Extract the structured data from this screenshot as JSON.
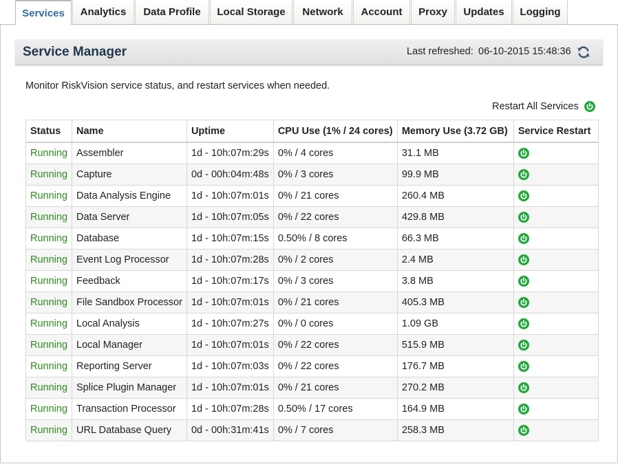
{
  "tabs": [
    {
      "label": "Services",
      "active": true
    },
    {
      "label": "Analytics"
    },
    {
      "label": "Data Profile"
    },
    {
      "label": "Local Storage"
    },
    {
      "label": "Network"
    },
    {
      "label": "Account"
    },
    {
      "label": "Proxy"
    },
    {
      "label": "Updates"
    },
    {
      "label": "Logging"
    }
  ],
  "header": {
    "title": "Service Manager",
    "refresh_label": "Last refreshed:",
    "refresh_value": "06-10-2015 15:48:36",
    "refresh_icon": "refresh-icon"
  },
  "description": "Monitor RiskVision service status, and restart services when needed.",
  "restart_all": {
    "label": "Restart All Services",
    "icon": "power-icon"
  },
  "colors": {
    "accent": "#2f6da1",
    "running": "#2d8a1e",
    "power_green": "#22a83a"
  },
  "table": {
    "columns": [
      "Status",
      "Name",
      "Uptime",
      "CPU Use (1% / 24 cores)",
      "Memory Use (3.72 GB)",
      "Service Restart"
    ],
    "rows": [
      {
        "status": "Running",
        "name": "Assembler",
        "uptime": "1d - 10h:07m:29s",
        "cpu": "0% / 4 cores",
        "mem": "31.1 MB"
      },
      {
        "status": "Running",
        "name": "Capture",
        "uptime": "0d - 00h:04m:48s",
        "cpu": "0% / 3 cores",
        "mem": "99.9 MB"
      },
      {
        "status": "Running",
        "name": "Data Analysis Engine",
        "uptime": "1d - 10h:07m:01s",
        "cpu": "0% / 21 cores",
        "mem": "260.4 MB"
      },
      {
        "status": "Running",
        "name": "Data Server",
        "uptime": "1d - 10h:07m:05s",
        "cpu": "0% / 22 cores",
        "mem": "429.8 MB"
      },
      {
        "status": "Running",
        "name": "Database",
        "uptime": "1d - 10h:07m:15s",
        "cpu": "0.50% / 8 cores",
        "mem": "66.3 MB"
      },
      {
        "status": "Running",
        "name": "Event Log Processor",
        "uptime": "1d - 10h:07m:28s",
        "cpu": "0% / 2 cores",
        "mem": "2.4 MB"
      },
      {
        "status": "Running",
        "name": "Feedback",
        "uptime": "1d - 10h:07m:17s",
        "cpu": "0% / 3 cores",
        "mem": "3.8 MB"
      },
      {
        "status": "Running",
        "name": "File Sandbox Processor",
        "uptime": "1d - 10h:07m:01s",
        "cpu": "0% / 21 cores",
        "mem": "405.3 MB"
      },
      {
        "status": "Running",
        "name": "Local Analysis",
        "uptime": "1d - 10h:07m:27s",
        "cpu": "0% / 0 cores",
        "mem": "1.09 GB"
      },
      {
        "status": "Running",
        "name": "Local Manager",
        "uptime": "1d - 10h:07m:01s",
        "cpu": "0% / 22 cores",
        "mem": "515.9 MB"
      },
      {
        "status": "Running",
        "name": "Reporting Server",
        "uptime": "1d - 10h:07m:03s",
        "cpu": "0% / 22 cores",
        "mem": "176.7 MB"
      },
      {
        "status": "Running",
        "name": "Splice Plugin Manager",
        "uptime": "1d - 10h:07m:01s",
        "cpu": "0% / 21 cores",
        "mem": "270.2 MB"
      },
      {
        "status": "Running",
        "name": "Transaction Processor",
        "uptime": "1d - 10h:07m:28s",
        "cpu": "0.50% / 17 cores",
        "mem": "164.9 MB"
      },
      {
        "status": "Running",
        "name": "URL Database Query",
        "uptime": "0d - 00h:31m:41s",
        "cpu": "0% / 7 cores",
        "mem": "258.3 MB"
      }
    ]
  }
}
